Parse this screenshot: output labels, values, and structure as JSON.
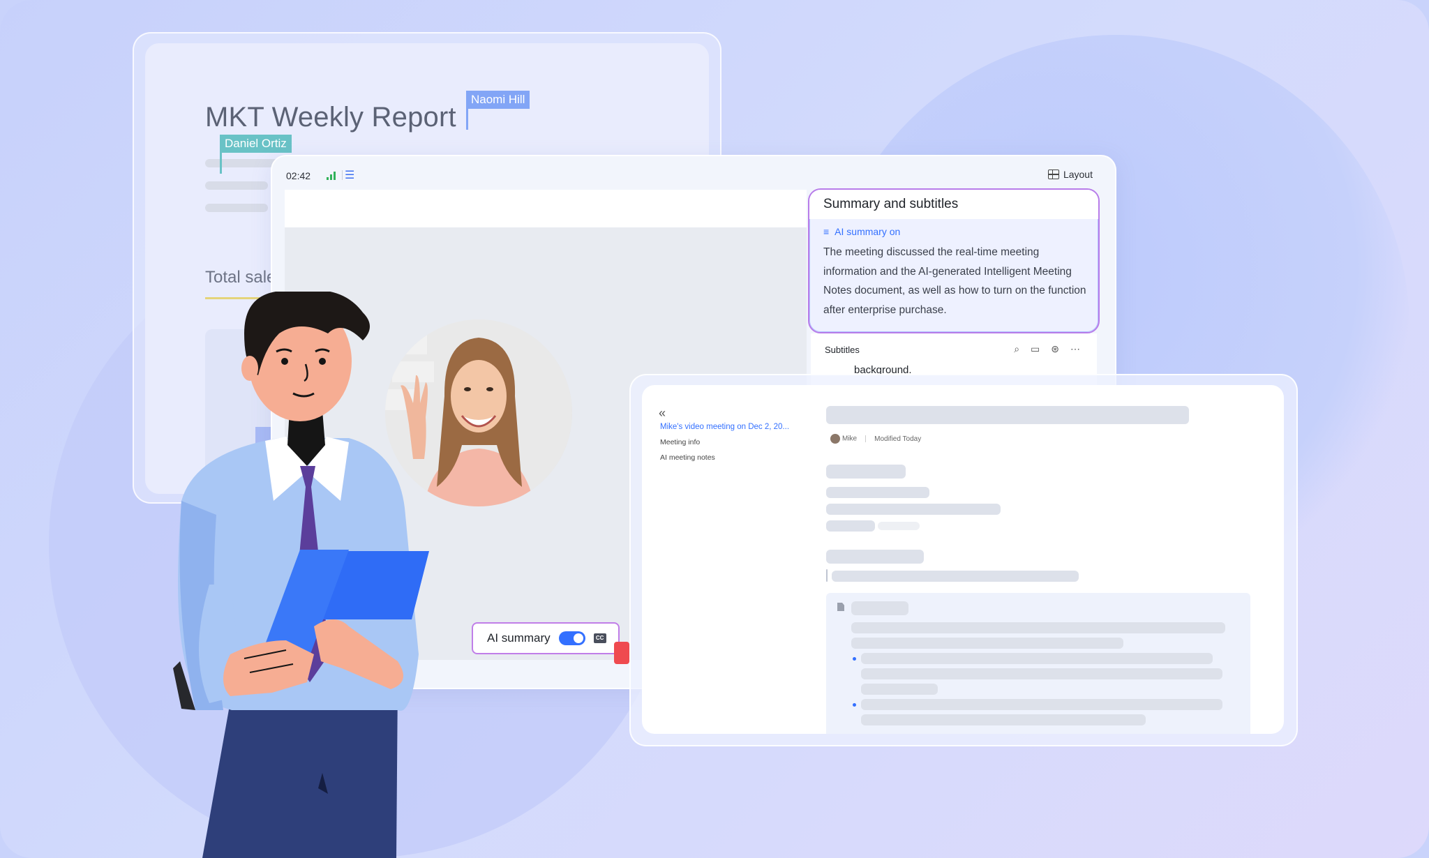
{
  "report": {
    "title": "MKT Weekly Report",
    "collaborators": [
      "Naomi Hill",
      "Daniel Ortiz"
    ],
    "section_label": "Total sale"
  },
  "meeting": {
    "timer": "02:42",
    "layout_label": "Layout",
    "summary_panel": {
      "title": "Summary and subtitles",
      "status": "AI summary on",
      "text": "The meeting discussed the real-time meeting information and the AI-generated Intelligent Meeting Notes document, as well as how to turn on the function after enterprise purchase."
    },
    "subtitles": {
      "label": "Subtitles",
      "current_text": "background."
    },
    "ai_summary_toggle": {
      "label": "AI summary",
      "enabled": true,
      "cc_label": "CC"
    }
  },
  "notes": {
    "back_icon": "double-chevron-left-icon",
    "meeting_title": "Mike's video meeting on Dec 2, 20...",
    "nav": [
      "Meeting info",
      "AI meeting notes"
    ],
    "author": "Mike",
    "modified": "Modified Today"
  },
  "colors": {
    "accent": "#3370ff",
    "highlight_border": "#b87ce9",
    "background": "#c9d3fb"
  }
}
